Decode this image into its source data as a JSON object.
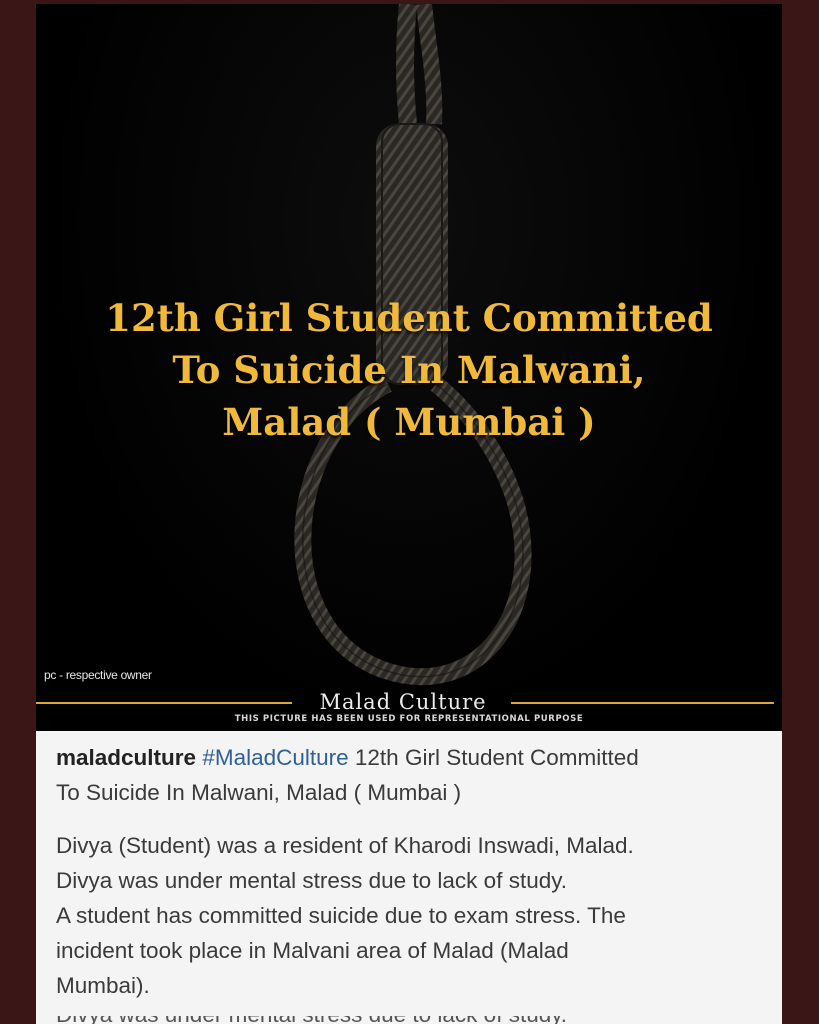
{
  "poster": {
    "headline_lines": [
      "12th Girl Student Committed",
      "To Suicide In Malwani,",
      "Malad ( Mumbai )"
    ],
    "credit": "pc - respective owner",
    "brand": "Malad Culture",
    "disclaimer": "THIS PICTURE HAS BEEN USED FOR REPRESENTATIONAL PURPOSE",
    "colors": {
      "headline": "#f0b93a",
      "rule": "#d9a73a"
    }
  },
  "caption": {
    "username": "maladculture",
    "hashtag": "#MaladCulture",
    "title_line1": "12th Girl Student Committed",
    "title_line2": "To Suicide In Malwani, Malad ( Mumbai )",
    "body_lines": [
      "Divya (Student) was a resident of Kharodi Inswadi, Malad.",
      "Divya was under mental stress due to lack of study.",
      "A student has committed suicide due to exam stress.  The",
      "incident took place in Malvani area of Malad (Malad",
      "Mumbai)."
    ],
    "cut_off_line": "Divya was under mental stress due to lack of study."
  }
}
